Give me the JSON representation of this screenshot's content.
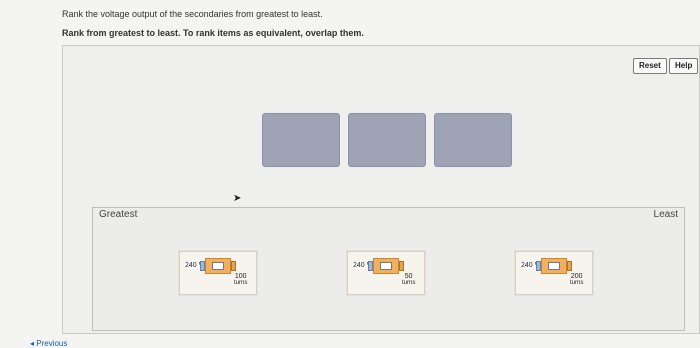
{
  "instructions": {
    "line1": "Rank the voltage output of the secondaries from greatest to least.",
    "line2": "Rank from greatest to least. To rank items as equivalent, overlap them."
  },
  "buttons": {
    "reset": "Reset",
    "help": "Help"
  },
  "ranking": {
    "left_label": "Greatest",
    "right_label": "Least"
  },
  "cards": [
    {
      "voltage": "240 V",
      "turns": "100",
      "unit": "turns"
    },
    {
      "voltage": "240 V",
      "turns": "50",
      "unit": "turns"
    },
    {
      "voltage": "240 V",
      "turns": "200",
      "unit": "turns"
    }
  ],
  "nav": {
    "previous": "◂ Previous"
  },
  "colors": {
    "slot": "#9fa3b6",
    "core_orange": "#f0b060",
    "link": "#1a5fa8"
  }
}
